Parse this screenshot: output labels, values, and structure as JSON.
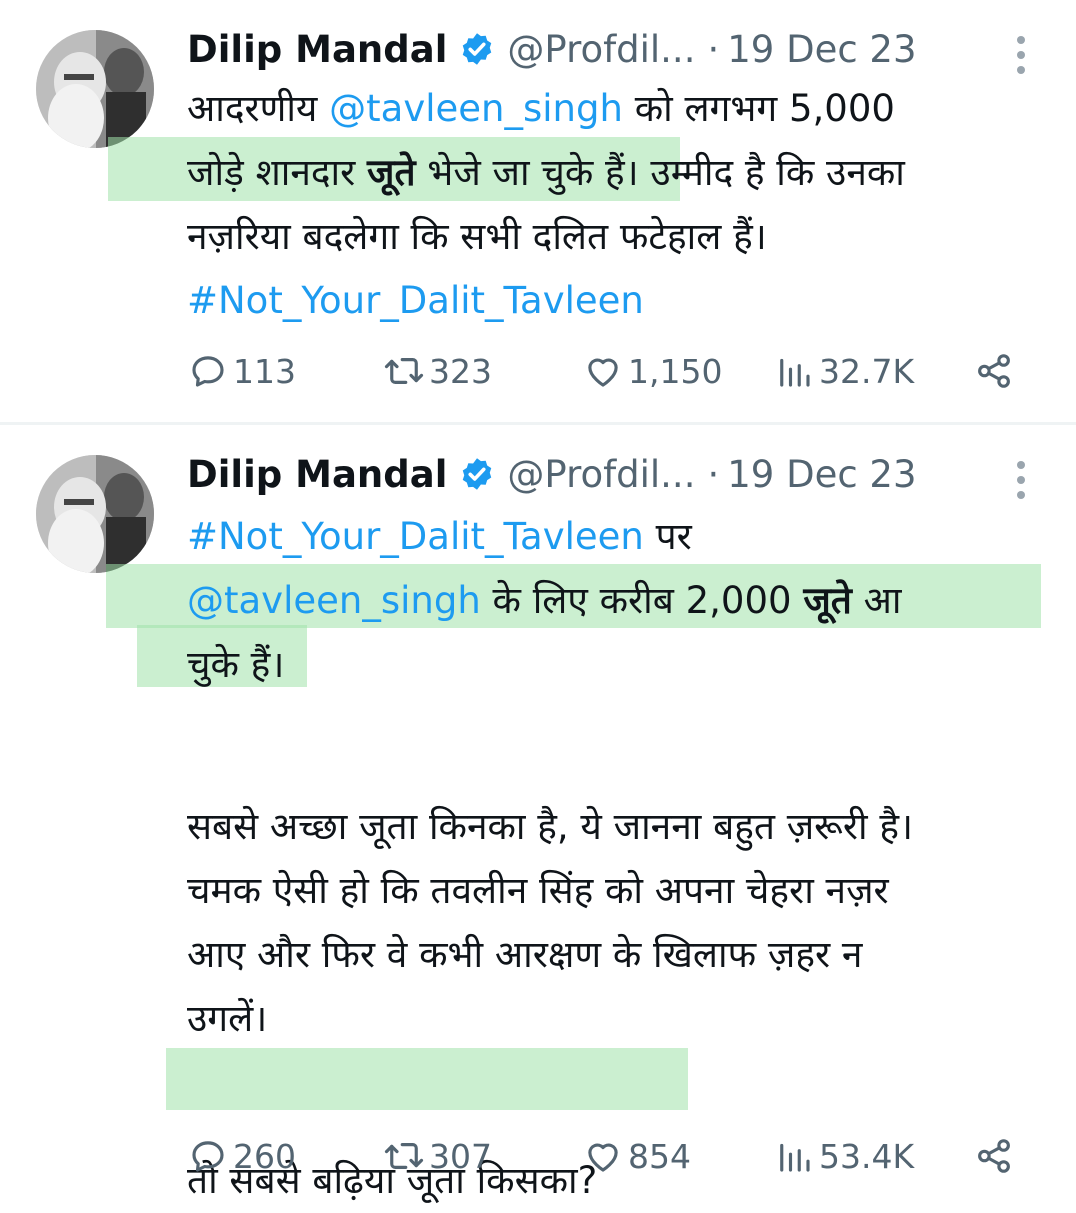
{
  "tweets": [
    {
      "author": {
        "name": "Dilip Mandal",
        "handle": "@Profdil...",
        "separator": "·",
        "date": "19 Dec 23"
      },
      "lines": [
        [
          "आदरणीय ",
          "@tavleen_singh",
          " को लगभग 5,000"
        ],
        [
          "जोड़े शानदार ",
          "जूते",
          " भेजे जा चुके हैं। उम्मीद है कि उनका"
        ],
        [
          "नज़रिया बदलेगा कि सभी दलित फटेहाल हैं।"
        ],
        [
          "#Not_Your_Dalit_Tavleen"
        ]
      ],
      "stats": {
        "replies": "113",
        "reposts": "323",
        "likes": "1,150",
        "views": "32.7K"
      }
    },
    {
      "author": {
        "name": "Dilip Mandal",
        "handle": "@Profdil...",
        "separator": "·",
        "date": "19 Dec 23"
      },
      "lines": [
        [
          "#Not_Your_Dalit_Tavleen",
          " पर"
        ],
        [
          "@tavleen_singh",
          " के लिए करीब 2,000 ",
          "जूते",
          " आ"
        ],
        [
          "चुके हैं।"
        ],
        [
          "सबसे अच्छा जूता किनका है, ये जानना बहुत ज़रूरी है।"
        ],
        [
          "चमक ऐसी हो कि तवलीन सिंह को अपना चेहरा नज़र"
        ],
        [
          "आए और फिर वे कभी आरक्षण के खिलाफ ज़हर न"
        ],
        [
          "उगलें।"
        ],
        [
          "तो सबसे बढ़िया जूता किसका?"
        ]
      ],
      "stats": {
        "replies": "260",
        "reposts": "307",
        "likes": "854",
        "views": "53.4K"
      }
    }
  ],
  "icons": {
    "verified": "verified-badge-icon",
    "more": "more-options-icon",
    "reply": "reply-icon",
    "repost": "repost-icon",
    "like": "like-icon",
    "views": "views-icon",
    "share": "share-icon"
  },
  "colors": {
    "link": "#1d9bf0",
    "text": "#0f1419",
    "secondary": "#536471",
    "highlight": "#a0e1aa"
  }
}
